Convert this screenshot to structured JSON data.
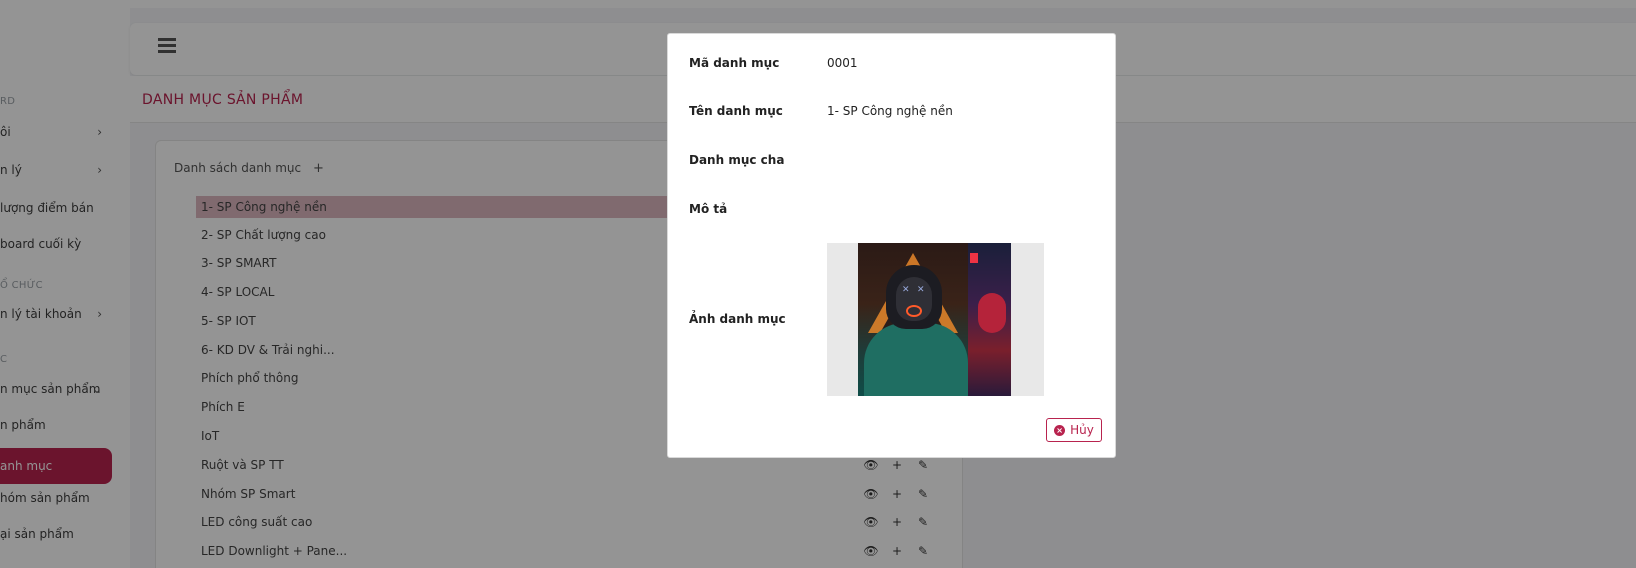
{
  "sidebar": {
    "section1": "RD",
    "item_dashboard": "ôi",
    "item_management": "n lý",
    "item_sales_qty": "lượng điểm bán",
    "item_final_dashboard": "board cuối kỳ",
    "section_org": "Ổ CHỨC",
    "item_accounts": "n lý tài khoản",
    "section_c": "C",
    "item_product_categories": "n mục sản phẩm",
    "item_products": "n phẩm",
    "item_categories_active": "anh mục",
    "item_product_groups": "hóm sản phẩm",
    "item_product_types": "ại sản phẩm"
  },
  "page": {
    "title": "DANH MỤC SẢN PHẨM"
  },
  "list": {
    "title": "Danh sách danh mục",
    "add_symbol": "+",
    "rows": [
      "1- SP Công nghệ nền",
      "2- SP Chất lượng cao",
      "3- SP SMART",
      "4- SP LOCAL",
      "5- SP IOT",
      "6- KD DV & Trải nghi...",
      "Phích phổ thông",
      "Phích E",
      "IoT",
      "Ruột và SP TT",
      "Nhóm SP Smart",
      "LED công suất cao",
      "LED Downlight + Pane..."
    ],
    "action_view": "👁",
    "action_add": "+",
    "action_edit": "✎"
  },
  "modal": {
    "code_label": "Mã danh mục",
    "code_value": "0001",
    "name_label": "Tên danh mục",
    "name_value": "1- SP Công nghệ nền",
    "parent_label": "Danh mục cha",
    "parent_value": "",
    "desc_label": "Mô tả",
    "desc_value": "",
    "image_label": "Ảnh danh mục",
    "cancel_label": "Hủy"
  },
  "colors": {
    "accent": "#b8234e",
    "selected_row": "#dcb7bf"
  }
}
